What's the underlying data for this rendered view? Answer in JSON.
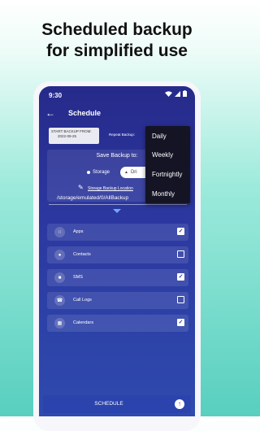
{
  "headline": {
    "line1": "Scheduled backup",
    "line2": "for simplified use"
  },
  "status_bar": {
    "time": "9:30"
  },
  "app_bar": {
    "back_icon": "arrow-left-icon",
    "title": "Schedule"
  },
  "start_backup": {
    "label": "START BACKUP FROM:",
    "date": "2022-09-25"
  },
  "repeat": {
    "label": "Repeat Backup:",
    "options": [
      "Daily",
      "Weekly",
      "Fortnightly",
      "Monthly"
    ]
  },
  "save_to": {
    "label": "Save Backup to:",
    "storage_label": "Storage",
    "drive_label": "Dri"
  },
  "location": {
    "label": "Storage Backup Location",
    "path": "/storage/emulated/0/AllBackup"
  },
  "items": [
    {
      "label": "Apps",
      "icon": "grid-icon",
      "checked": true
    },
    {
      "label": "Contacts",
      "icon": "person-icon",
      "checked": false
    },
    {
      "label": "SMS",
      "icon": "message-icon",
      "checked": true
    },
    {
      "label": "Call Logs",
      "icon": "phone-icon",
      "checked": false
    },
    {
      "label": "Calendars",
      "icon": "calendar-icon",
      "checked": true
    }
  ],
  "schedule_button": {
    "label": "SCHEDULE",
    "icon": "cloud-upload-icon"
  },
  "colors": {
    "screen_bg": "#2c38a0",
    "dropdown_bg": "#141425",
    "accent": "#58cfbf"
  }
}
